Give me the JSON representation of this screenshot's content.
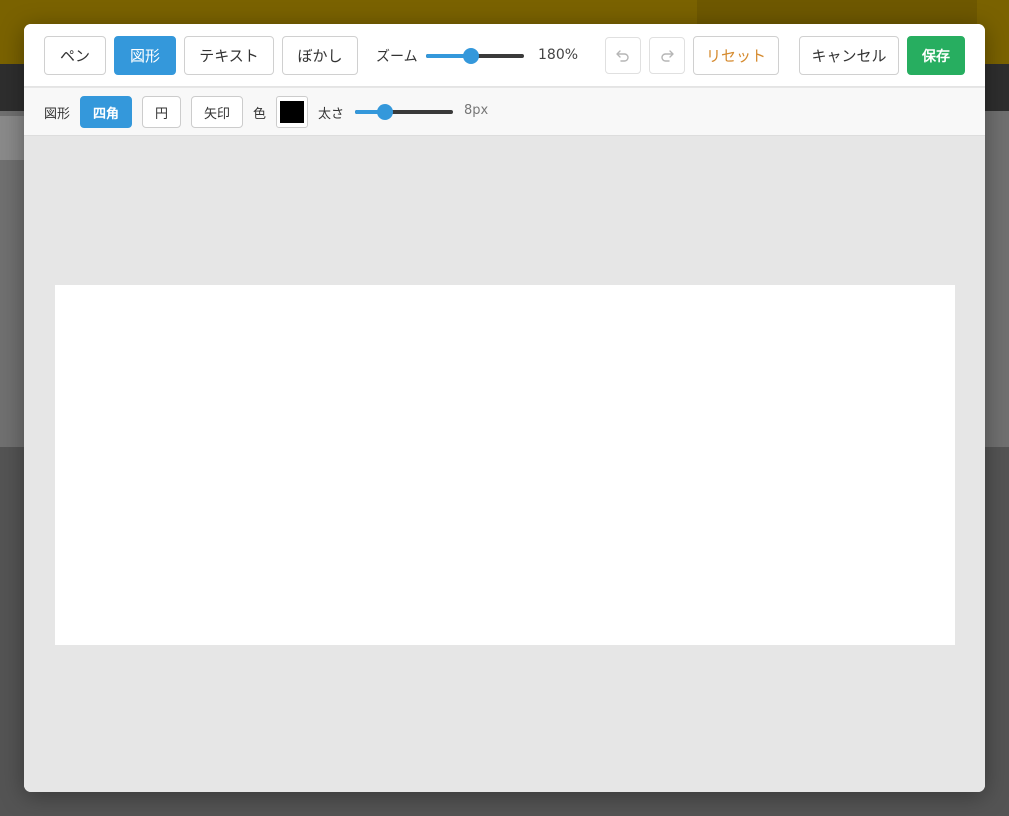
{
  "colors": {
    "accent": "#3498db",
    "save": "#27ae60",
    "reset_text": "#d58a2e",
    "stroke_color": "#000000"
  },
  "toolbar": {
    "tools": [
      {
        "id": "pen",
        "label": "ペン",
        "active": false
      },
      {
        "id": "shape",
        "label": "図形",
        "active": true
      },
      {
        "id": "text",
        "label": "テキスト",
        "active": false
      },
      {
        "id": "blur",
        "label": "ぼかし",
        "active": false
      }
    ],
    "zoom": {
      "label": "ズーム",
      "value_text": "180%",
      "value": 180,
      "level": 0.45
    },
    "undo_icon": "undo-icon",
    "redo_icon": "redo-icon",
    "reset_label": "リセット",
    "cancel_label": "キャンセル",
    "save_label": "保存"
  },
  "shape_options": {
    "label": "図形",
    "shapes": [
      {
        "id": "rect",
        "label": "四角",
        "active": true
      },
      {
        "id": "circle",
        "label": "円",
        "active": false
      },
      {
        "id": "arrow",
        "label": "矢印",
        "active": false
      }
    ],
    "color_label": "色",
    "thickness": {
      "label": "太さ",
      "value_text": "8px",
      "value": 8,
      "level": 0.27
    }
  }
}
